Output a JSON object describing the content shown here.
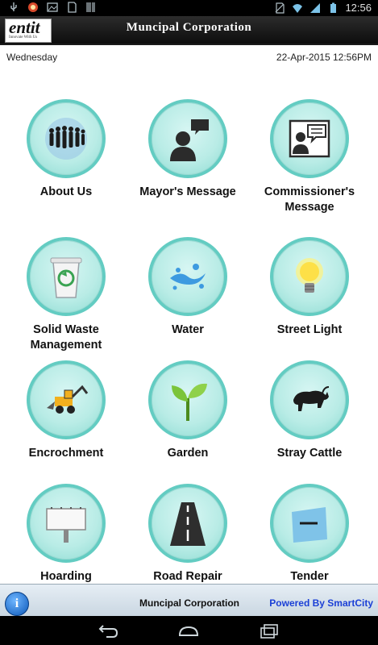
{
  "status_bar": {
    "time": "12:56",
    "icons": [
      "usb-icon",
      "app-notification-icon",
      "gallery-icon",
      "sd-card-icon",
      "barcode-icon",
      "no-sim-icon",
      "wifi-icon",
      "signal-icon",
      "battery-icon"
    ]
  },
  "header": {
    "logo_text": "entit",
    "logo_tagline": "Innovate With Us",
    "title": "Muncipal Corporation"
  },
  "date_row": {
    "day": "Wednesday",
    "timestamp": "22-Apr-2015 12:56PM"
  },
  "tiles": [
    {
      "label": "About Us",
      "icon": "people-group-icon"
    },
    {
      "label": "Mayor's Message",
      "icon": "person-speech-icon"
    },
    {
      "label": "Commissioner's Message",
      "icon": "commissioner-message-icon"
    },
    {
      "label": "Solid Waste Management",
      "icon": "recycle-bin-icon"
    },
    {
      "label": "Water",
      "icon": "water-splash-icon"
    },
    {
      "label": "Street Light",
      "icon": "light-bulb-icon"
    },
    {
      "label": "Encrochment",
      "icon": "excavator-icon"
    },
    {
      "label": "Garden",
      "icon": "plant-icon"
    },
    {
      "label": "Stray Cattle",
      "icon": "bull-icon"
    },
    {
      "label": "Hoarding",
      "icon": "billboard-icon"
    },
    {
      "label": "Road Repair",
      "icon": "road-icon"
    },
    {
      "label": "Tender",
      "icon": "tender-box-icon"
    }
  ],
  "footer": {
    "info_glyph": "i",
    "title": "Muncipal Corporation",
    "powered_by": "Powered By SmartCity"
  },
  "colors": {
    "circle_ring": "#63ccc2",
    "powered_link": "#1a3fd6",
    "header_bg": "#1a1a1a"
  }
}
